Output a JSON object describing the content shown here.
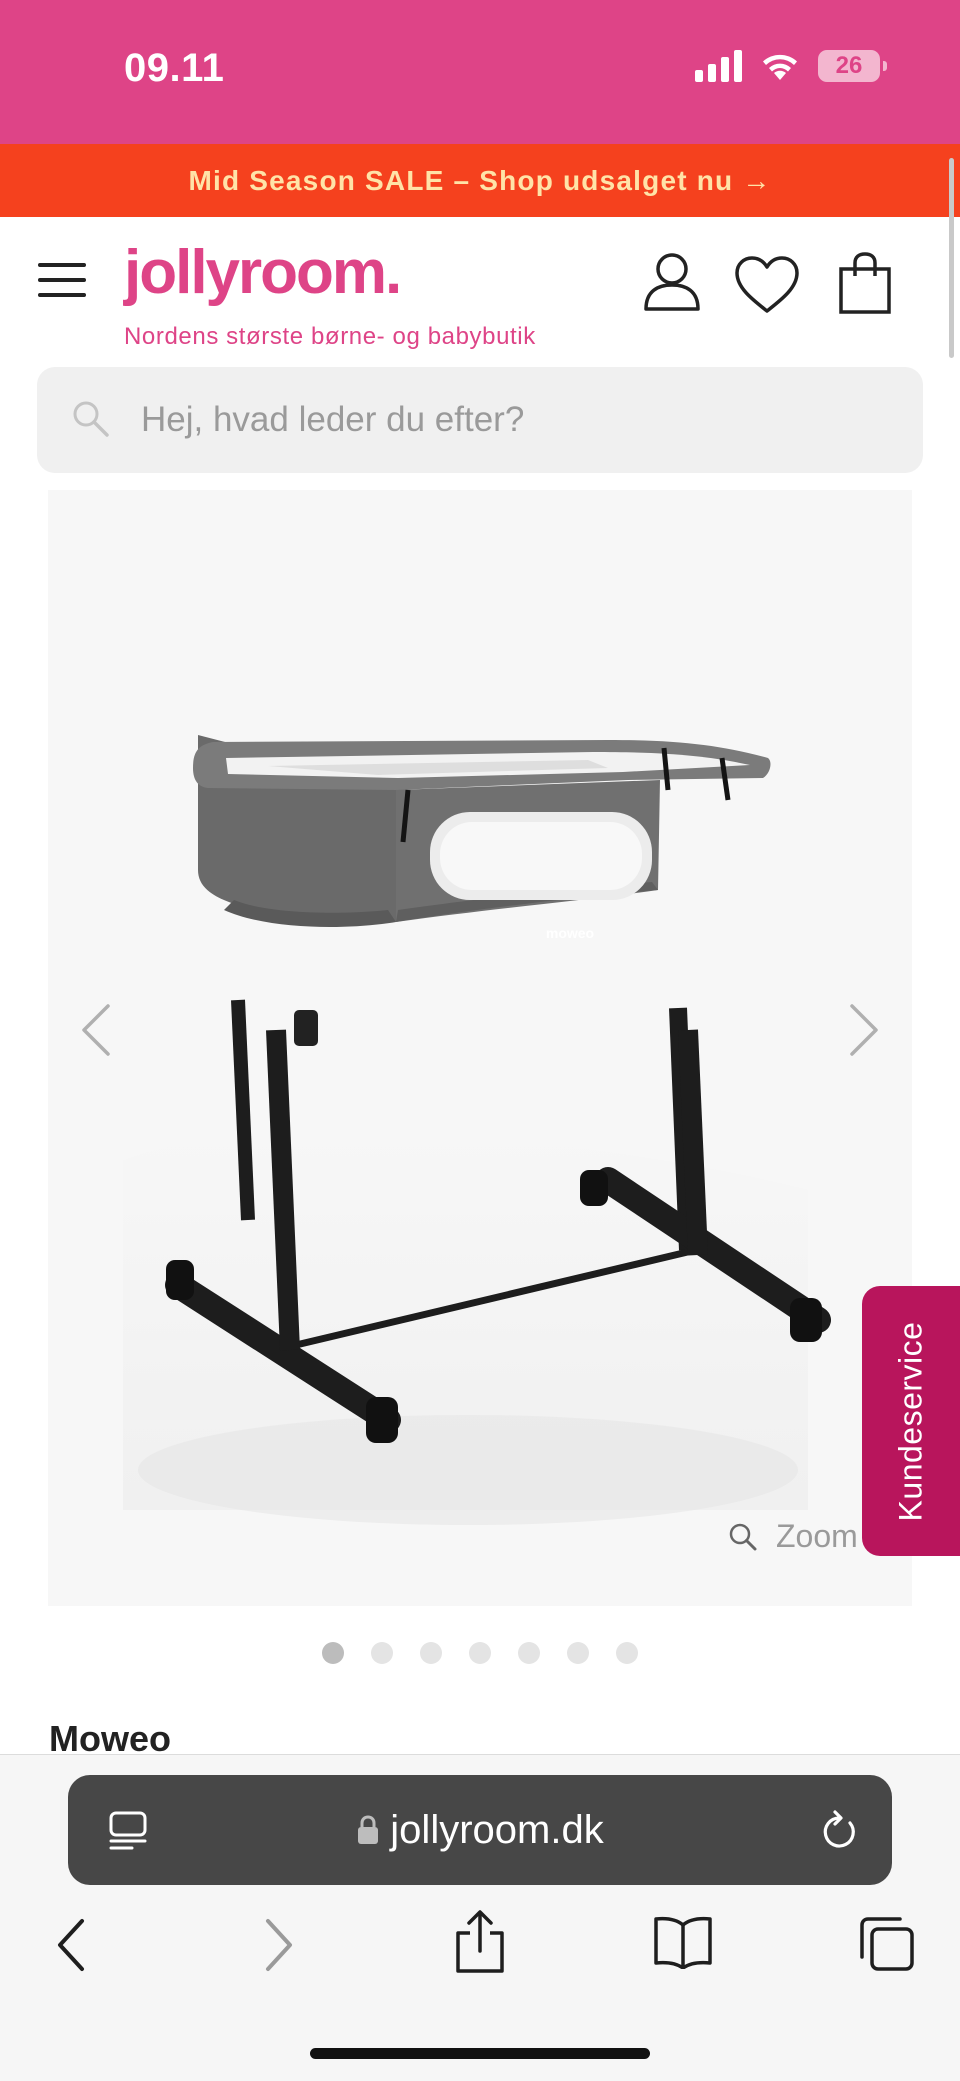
{
  "status_bar": {
    "time": "09.11",
    "battery": "26"
  },
  "promo": {
    "text": "Mid Season SALE – Shop udsalget nu →"
  },
  "header": {
    "logo": "jollyroom.",
    "tagline": "Nordens største børne- og babybutik",
    "icons": [
      "menu-icon",
      "user-icon",
      "heart-icon",
      "bag-icon"
    ]
  },
  "search": {
    "placeholder": "Hej, hvad leder du efter?"
  },
  "gallery": {
    "product_logo": "moweo",
    "zoom_label": "Zoom",
    "dots_count": 7,
    "active_dot": 1
  },
  "customer_service": {
    "label": "Kundeservice"
  },
  "product": {
    "brand": "Moweo"
  },
  "browser": {
    "url": "jollyroom.dk"
  },
  "colors": {
    "brand_pink": "#de4487",
    "promo_red": "#f5411e",
    "promo_text": "#ffe3a8",
    "service_tab": "#b8155c"
  }
}
